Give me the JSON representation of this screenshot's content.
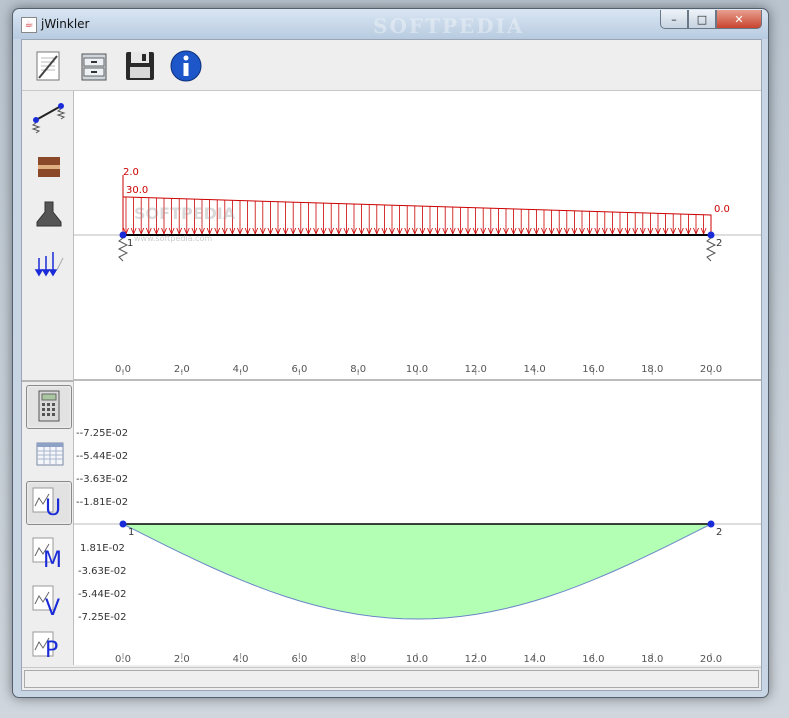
{
  "window": {
    "title": "jWinkler",
    "watermark": "SOFTPEDIA",
    "controls": {
      "minimize": "–",
      "maximize": "□",
      "close": "✕"
    }
  },
  "toolbar": {
    "icons": [
      "new-document-icon",
      "open-cabinet-icon",
      "save-disk-icon",
      "info-icon"
    ]
  },
  "left_panel": {
    "model_icons": [
      "beam-element-icon",
      "material-icon",
      "section-icon",
      "distributed-load-icon"
    ],
    "result_icons": [
      "calculator-icon",
      "table-icon",
      "plot-U-icon",
      "plot-M-icon",
      "plot-V-icon",
      "plot-P-icon"
    ],
    "result_letters": [
      "U",
      "M",
      "V",
      "P"
    ]
  },
  "upper_plot": {
    "load_labels": {
      "top_left": "2.0",
      "left": "30.0",
      "right": "0.0"
    },
    "node_labels": [
      "1",
      "2"
    ],
    "overlay_watermark": "SOFTPEDIA",
    "overlay_url": "www.softpedia.com",
    "axis_ticks": [
      "0.0",
      "2.0",
      "4.0",
      "6.0",
      "8.0",
      "10.0",
      "12.0",
      "14.0",
      "16.0",
      "18.0",
      "20.0"
    ]
  },
  "lower_plot": {
    "y_labels_upper": [
      "--7.25E-02",
      "--5.44E-02",
      "--3.63E-02",
      "--1.81E-02"
    ],
    "y_labels_lower": [
      "1.81E-02",
      "-3.63E-02",
      "-5.44E-02",
      "-7.25E-02"
    ],
    "node_labels": [
      "1",
      "2"
    ],
    "axis_ticks": [
      "0.0",
      "2.0",
      "4.0",
      "6.0",
      "8.0",
      "10.0",
      "12.0",
      "14.0",
      "16.0",
      "18.0",
      "20.0"
    ],
    "curve_color": "#b3ffb3",
    "curve_depth": 7.25
  },
  "colors": {
    "load": "#cc0000",
    "node": "#1a2bd8",
    "axis": "#555555"
  },
  "chart_data": {
    "type": "area",
    "x": [
      0,
      2,
      4,
      6,
      8,
      10,
      12,
      14,
      16,
      18,
      20
    ],
    "y_ticks": [
      "--7.25E-02",
      "--5.44E-02",
      "--3.63E-02",
      "--1.81E-02",
      "1.81E-02",
      "-3.63E-02",
      "-5.44E-02",
      "-7.25E-02"
    ],
    "x_range": [
      0,
      20
    ],
    "shape": "parabolic sag, zero at x=0 and x=20, minimum near x=10",
    "fill_color": "#b3ffb3"
  }
}
